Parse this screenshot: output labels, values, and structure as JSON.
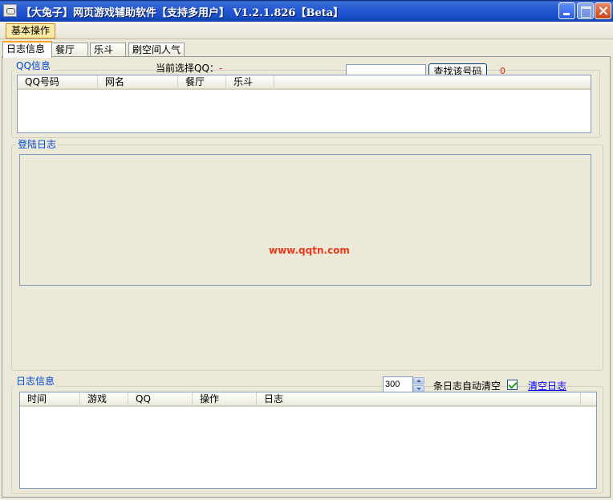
{
  "window": {
    "title": "【大兔子】网页游戏辅助软件【支持多用户】 V1.2.1.826【Beta】"
  },
  "menu": {
    "items": [
      "基本操作"
    ]
  },
  "tabs": [
    "日志信息",
    "餐厅",
    "乐斗",
    "刷空间人气"
  ],
  "qq_info": {
    "group_label": "QQ信息",
    "current_label": "当前选择QQ：",
    "current_value": "-",
    "search_value": "",
    "search_button": "查找该号码",
    "count": "0",
    "columns": [
      "QQ号码",
      "网名",
      "餐厅",
      "乐斗"
    ]
  },
  "login_log": {
    "group_label": "登陆日志",
    "watermark": "www.qqtn.com"
  },
  "log_info": {
    "group_label": "日志信息",
    "limit_value": "300",
    "auto_clear_label": "条日志自动清空",
    "auto_clear_checked": true,
    "clear_link": "清空日志",
    "columns": [
      "时间",
      "游戏",
      "QQ",
      "操作",
      "日志"
    ]
  }
}
